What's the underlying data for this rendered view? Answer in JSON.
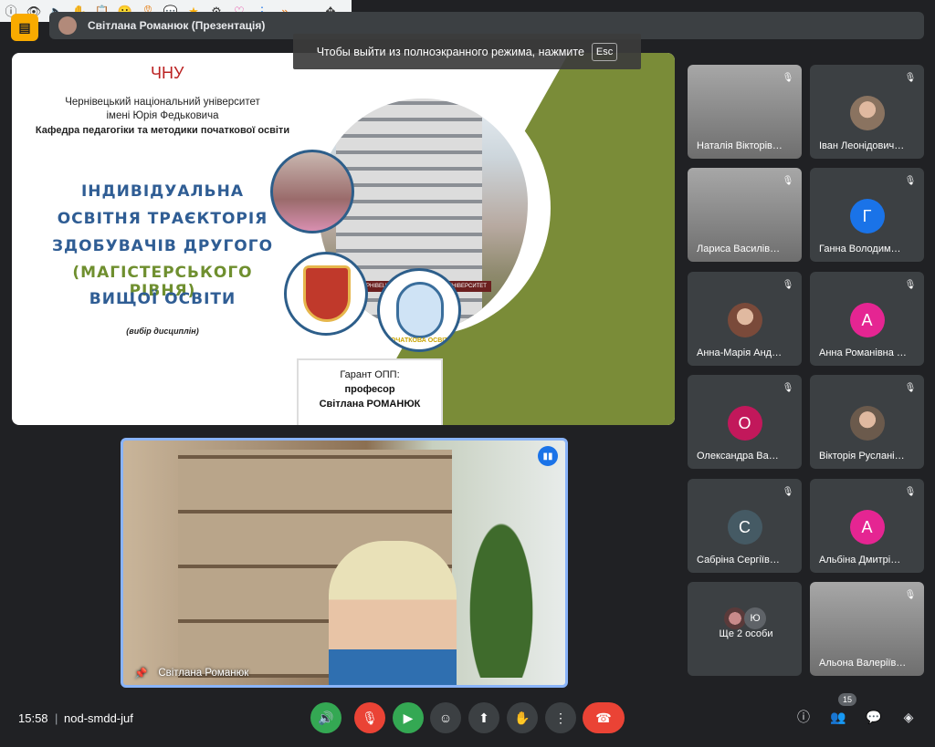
{
  "toolbar_extensions": [
    "info-icon",
    "eye-icon",
    "speaker-icon",
    "hand-icon",
    "clipboard-icon",
    "emoji-icon",
    "ribbon-icon",
    "chat-icon",
    "star-icon",
    "gear-icon",
    "heart-icon",
    "menu-dots-icon",
    "forward-icon",
    "minimize-icon",
    "move-icon"
  ],
  "topbar": {
    "presenter_label": "Світлана Романюк (Презентація)"
  },
  "fullscreen_toast": {
    "text": "Чтобы выйти из полноэкранного режима, нажмите",
    "key": "Esc"
  },
  "slide": {
    "university": "Чернівецький національний університет",
    "university2": "імені Юрія Федьковича",
    "department": "Кафедра педагогіки та методики початкової освіти",
    "title_lines": [
      "ІНДИВІДУАЛЬНА",
      "ОСВІТНЯ ТРАЄКТОРІЯ",
      "ЗДОБУВАЧІВ ДРУГОГО",
      "(МАГІСТЕРСЬКОГО РІВНЯ)",
      "ВИЩОЇ ОСВІТИ"
    ],
    "subtitle": "(вибір дисциплін)",
    "guarantor_label": "Гарант ОПП:",
    "guarantor_title": "професор",
    "guarantor_name": "Світлана РОМАНЮК",
    "building_sign": "ЧЕРНІВЕЦЬКИЙ НАЦІОНАЛЬНИЙ УНІВЕРСИТЕТ",
    "crest2_label": "ПОЧАТКОВА ОСВІТА"
  },
  "main_video": {
    "name": "Світлана Романюк"
  },
  "tiles": [
    {
      "name": "Наталія Вікторів…",
      "type": "video"
    },
    {
      "name": "Іван Леонідович…",
      "type": "photo",
      "color": "#8a7360"
    },
    {
      "name": "Лариса Василів…",
      "type": "video"
    },
    {
      "name": "Ганна Володим…",
      "type": "letter",
      "letter": "Г",
      "color": "#1a73e8"
    },
    {
      "name": "Анна-Марія Анд…",
      "type": "photo",
      "color": "#7a4a3a"
    },
    {
      "name": "Анна Романівна …",
      "type": "letter",
      "letter": "А",
      "color": "#e52592"
    },
    {
      "name": "Олександра Ва…",
      "type": "letter",
      "letter": "О",
      "color": "#c2185b"
    },
    {
      "name": "Вікторія Руслані…",
      "type": "photo",
      "color": "#6b5a4c"
    },
    {
      "name": "Сабріна Сергіїв…",
      "type": "letter",
      "letter": "С",
      "color": "#455a64"
    },
    {
      "name": "Альбіна Дмитрі…",
      "type": "letter",
      "letter": "А",
      "color": "#e52592"
    },
    {
      "name": "Ще 2 особи",
      "type": "more",
      "letter": "Ю"
    },
    {
      "name": "Альона Валеріїв…",
      "type": "video"
    }
  ],
  "bottom": {
    "time": "15:58",
    "separator": "|",
    "meeting_code": "nod-smdd-juf",
    "people_count": "15"
  },
  "colors": {
    "bg": "#202124",
    "tile": "#3c4043",
    "red": "#ea4335",
    "green": "#34a853",
    "accent": "#1a73e8"
  }
}
